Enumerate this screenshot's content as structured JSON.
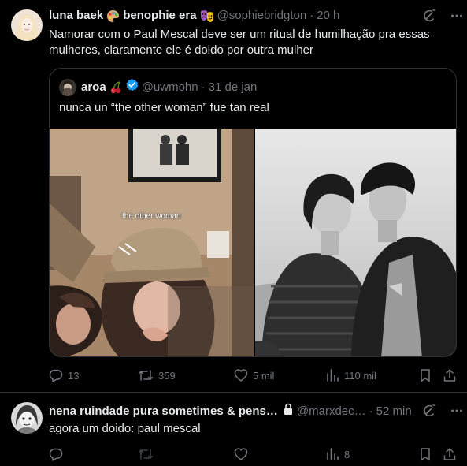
{
  "tweet1": {
    "name": "luna baek",
    "name_suffix": "benophie era",
    "handle": "@sophiebridgton",
    "separator": "·",
    "time": "20 h",
    "text_line1": "Namorar com o Paul Mescal deve ser um ritual de humilhação pra essas",
    "text_line2": "mulheres, claramente ele é doido por outra mulher",
    "quote": {
      "name": "aroa",
      "handle": "@uwmohn",
      "separator": "·",
      "time": "31 de jan",
      "text": "nunca un “the other woman” fue tan real",
      "media_caption": "the other woman"
    },
    "actions": {
      "replies": "13",
      "retweets": "359",
      "likes": "5 mil",
      "views": "110 mil"
    }
  },
  "tweet2": {
    "name": "nena ruindade pura sometimes & pens…",
    "handle": "@marxdec…",
    "separator": "·",
    "time": "52 min",
    "text": "agora um doido: paul mescal",
    "actions": {
      "replies": "",
      "retweets": "",
      "likes": "",
      "views": "8"
    }
  },
  "colors": {
    "background": "#000000",
    "text": "#e7e9ea",
    "secondary": "#71767b",
    "border": "#2f3336",
    "verified": "#1d9bf0"
  },
  "icons": [
    "grok-icon",
    "more-icon",
    "verified-badge-icon",
    "lock-icon",
    "reply-icon",
    "retweet-icon",
    "like-icon",
    "views-icon",
    "bookmark-icon",
    "share-icon"
  ]
}
